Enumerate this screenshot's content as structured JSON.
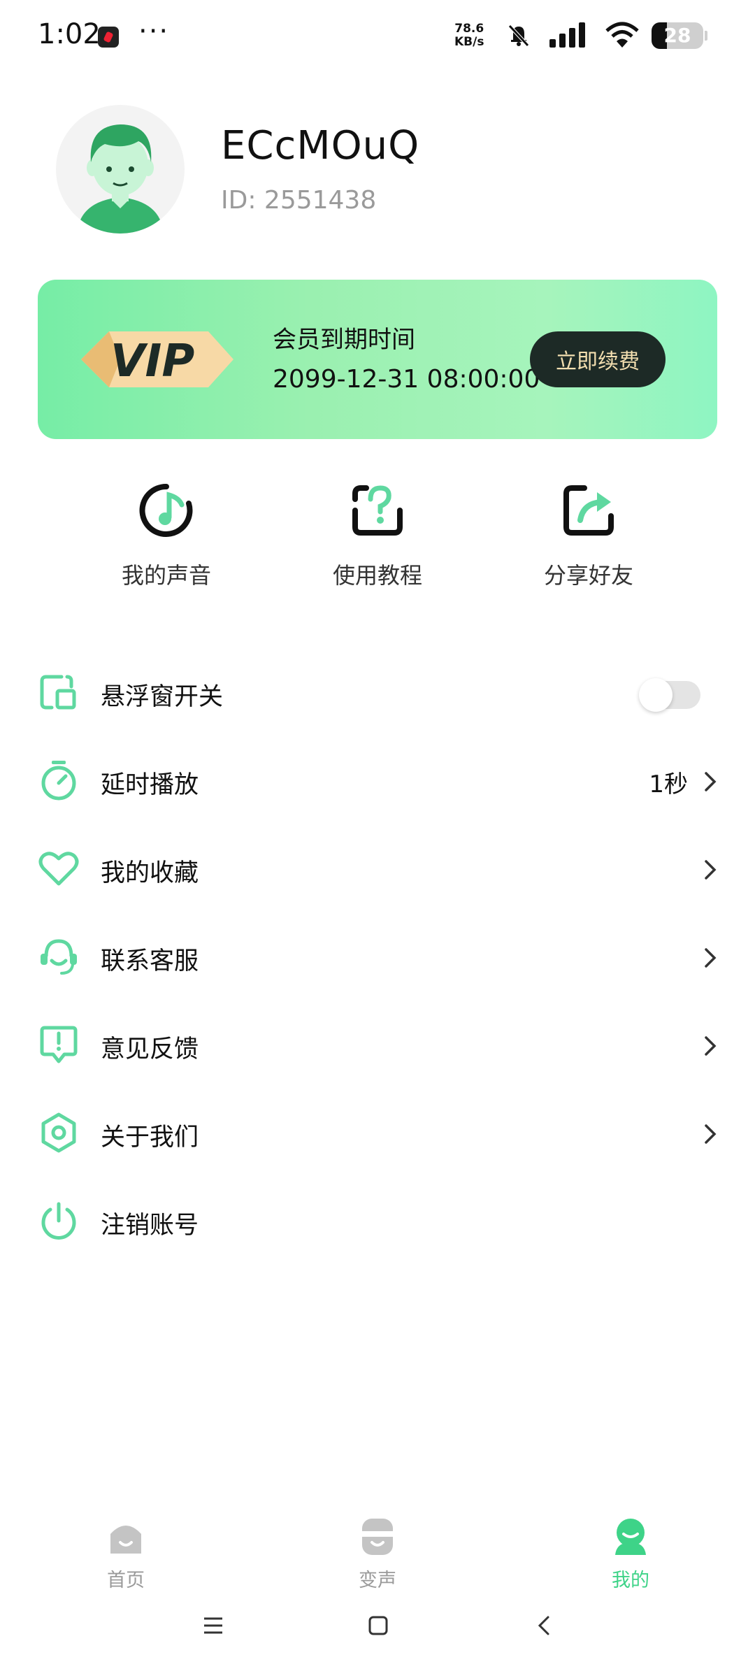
{
  "status_bar": {
    "time": "1:02",
    "more": "···",
    "net_speed_value": "78.6",
    "net_speed_unit": "KB/s",
    "battery": "28"
  },
  "profile": {
    "username": "ECcMOuQ",
    "id_text": "ID:  2551438"
  },
  "vip": {
    "badge": "VIP",
    "expiry_label": "会员到期时间",
    "expiry_date": "2099-12-31 08:00:00",
    "renew_label": "立即续费"
  },
  "quick_actions": [
    {
      "label": "我的声音",
      "icon": "music-note-icon"
    },
    {
      "label": "使用教程",
      "icon": "help-icon"
    },
    {
      "label": "分享好友",
      "icon": "share-icon"
    }
  ],
  "menu": [
    {
      "label": "悬浮窗开关",
      "icon": "floating-window-icon",
      "value": "",
      "control": "toggle",
      "toggle_on": false
    },
    {
      "label": "延时播放",
      "icon": "timer-icon",
      "value": "1秒",
      "control": "chevron"
    },
    {
      "label": "我的收藏",
      "icon": "heart-icon",
      "value": "",
      "control": "chevron"
    },
    {
      "label": "联系客服",
      "icon": "headset-icon",
      "value": "",
      "control": "chevron"
    },
    {
      "label": "意见反馈",
      "icon": "feedback-icon",
      "value": "",
      "control": "chevron"
    },
    {
      "label": "关于我们",
      "icon": "about-icon",
      "value": "",
      "control": "chevron"
    },
    {
      "label": "注销账号",
      "icon": "power-icon",
      "value": "",
      "control": "none"
    }
  ],
  "bottom_nav": [
    {
      "label": "首页",
      "icon": "home-icon",
      "active": false
    },
    {
      "label": "变声",
      "icon": "voice-change-icon",
      "active": false
    },
    {
      "label": "我的",
      "icon": "profile-icon",
      "active": true
    }
  ],
  "colors": {
    "accent": "#3ed388",
    "icon_green": "#5fd8a0",
    "vip_dark": "#1d2a26",
    "vip_gold": "#f3dfb0"
  }
}
